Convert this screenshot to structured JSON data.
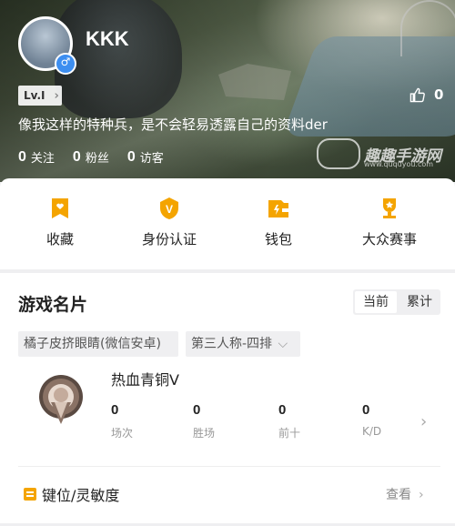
{
  "profile": {
    "username": "KKK",
    "gender_symbol": "♂",
    "level": "Lv.I",
    "bio": "像我这样的特种兵，是不会轻易透露自己的资料der",
    "stats": [
      {
        "value": "0",
        "label": "关注"
      },
      {
        "value": "0",
        "label": "粉丝"
      },
      {
        "value": "0",
        "label": "访客"
      }
    ],
    "likes": "0"
  },
  "watermark": {
    "text": "趣趣手游网",
    "url": "www.ququyou.com"
  },
  "actions": [
    {
      "label": "收藏",
      "icon": "bookmark-heart-icon"
    },
    {
      "label": "身份认证",
      "icon": "verified-shield-icon"
    },
    {
      "label": "钱包",
      "icon": "wallet-icon"
    },
    {
      "label": "大众赛事",
      "icon": "trophy-icon"
    }
  ],
  "game_card": {
    "title": "游戏名片",
    "toggle": {
      "current": "当前",
      "cumulative": "累计",
      "selected": "当前"
    },
    "server_tag": "橘子皮挤眼睛(微信安卓)",
    "mode_tag": "第三人称-四排",
    "rank_name": "热血青铜V",
    "metrics": [
      {
        "value": "0",
        "label": "场次"
      },
      {
        "value": "0",
        "label": "胜场"
      },
      {
        "value": "0",
        "label": "前十"
      },
      {
        "value": "0",
        "label": "K/D"
      }
    ],
    "keys_label": "键位/灵敏度",
    "view_label": "查看"
  },
  "colors": {
    "accent": "#f4a400",
    "gender": "#3d8ef0"
  }
}
